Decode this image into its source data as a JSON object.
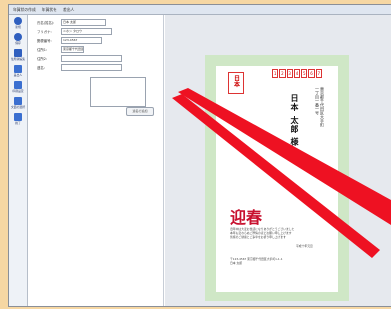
{
  "menubar": {
    "items": [
      "年賀状の作成",
      "年賀状を",
      "差出人"
    ]
  },
  "toolbar": {
    "items": [
      {
        "label": "新規",
        "icon": "new-icon",
        "color": "#2f5fbf"
      },
      {
        "label": "保存",
        "icon": "save-icon",
        "color": "#2f5fbf"
      },
      {
        "label": "住所録編集",
        "icon": "address-book-icon",
        "color": "#2f5fbf"
      },
      {
        "label": "差出人",
        "icon": "sender-icon",
        "color": "#3a6fd0"
      },
      {
        "label": "印刷設定",
        "icon": "print-settings-icon",
        "color": "#3a6fd0"
      },
      {
        "label": "文面の選択",
        "icon": "design-icon",
        "color": "#3a6fd0"
      },
      {
        "label": "終了",
        "icon": "exit-icon",
        "color": "#3a6fd0"
      }
    ]
  },
  "form": {
    "fields": [
      {
        "label": "氏名(姓名):",
        "value": "日本 太郎"
      },
      {
        "label": "フリガナ:",
        "value": "ニホン タロウ"
      },
      {
        "label": "郵便番号:",
        "value": "123-4567"
      },
      {
        "label": "住所1:",
        "value": "東京都千代田区"
      },
      {
        "label": "住所2:",
        "value": ""
      },
      {
        "label": "連名:",
        "value": ""
      }
    ],
    "add_button": "連名の追加"
  },
  "postcard": {
    "stamp_label": "日本",
    "zip_digits": [
      "1",
      "2",
      "3",
      "4",
      "5",
      "6",
      "7"
    ],
    "address": [
      "東京都千代田区大手町",
      "一丁目一番一号"
    ],
    "recipient": "日本 太郎 様",
    "greeting_title": "迎春",
    "greeting_lines": [
      "旧年中は大変お世話になりありがとうございました",
      "本年も変わらぬご厚情のほどお願い申し上げます",
      "皆様のご健康とご多幸をお祈り申し上げます"
    ],
    "greeting_date": "平成十年元旦",
    "sender_lines": [
      "〒123-4567 東京都千代田区大手町1-1-1",
      "日本 太郎"
    ]
  },
  "colors": {
    "background": "#f6d7a3",
    "postcard_border": "#cfe7c6",
    "greeting_red": "#c8102e",
    "arrow": "#ee1122"
  }
}
